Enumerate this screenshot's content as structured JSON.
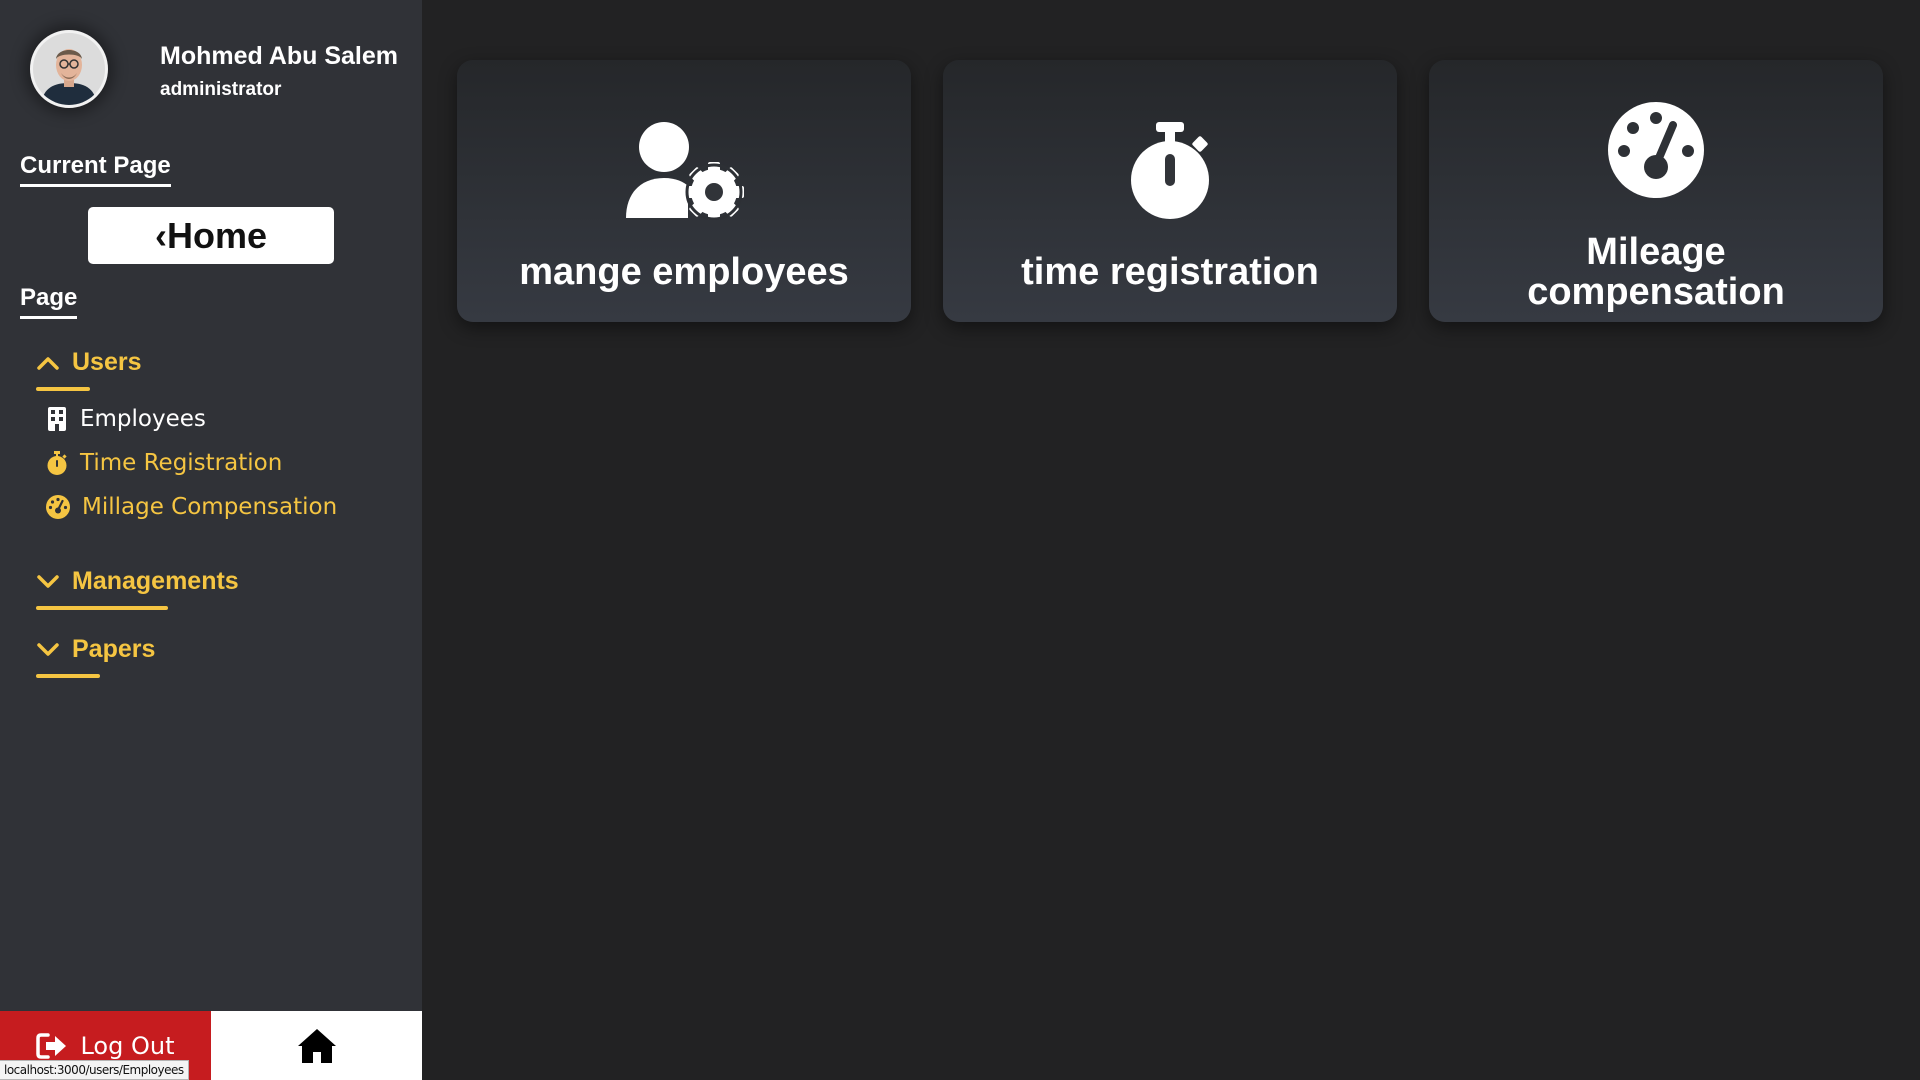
{
  "profile": {
    "name": "Mohmed Abu Salem",
    "role": "administrator"
  },
  "sidebar": {
    "current_page_label": "Current Page",
    "current_page_button": "‹Home",
    "page_label": "Page",
    "groups": [
      {
        "title": "Users",
        "expanded": true,
        "items": [
          {
            "label": "Employees",
            "icon": "building-icon",
            "color": "#ffffff"
          },
          {
            "label": "Time Registration",
            "icon": "stopwatch-icon",
            "color": "#f5c542"
          },
          {
            "label": "Millage Compensation",
            "icon": "gauge-icon",
            "color": "#f5c542"
          }
        ]
      },
      {
        "title": "Managements",
        "expanded": false
      },
      {
        "title": "Papers",
        "expanded": false
      }
    ],
    "logout_label": "Log Out"
  },
  "cards": [
    {
      "label": "mange employees",
      "icon": "user-gear-icon"
    },
    {
      "label": "time registration",
      "icon": "stopwatch-icon"
    },
    {
      "label_line1": "Mileage",
      "label_line2": "compensation",
      "icon": "gauge-icon"
    }
  ],
  "status_bar": {
    "url": "localhost:3000/users/Employees"
  },
  "colors": {
    "accent": "#f5c542",
    "logout": "#c61c1f",
    "sidebar_bg": "#303237",
    "main_bg": "#222223"
  }
}
